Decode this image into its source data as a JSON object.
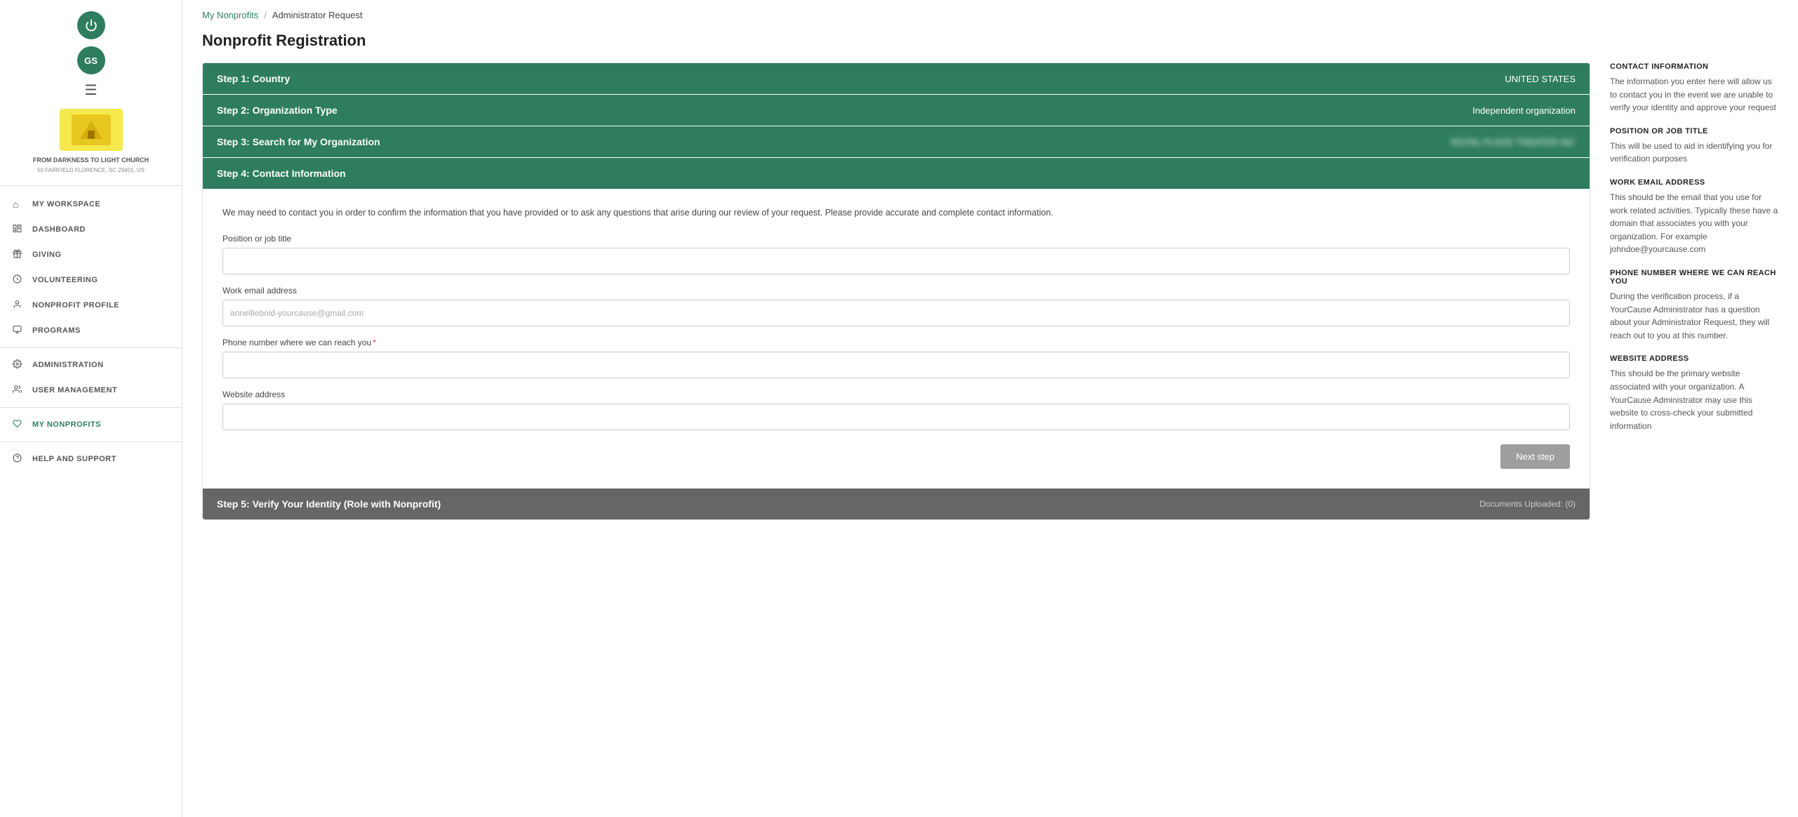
{
  "sidebar": {
    "power_icon": "⏻",
    "avatar_initials": "GS",
    "hamburger": "☰",
    "org_logo_letter": "🏠",
    "org_name": "FROM DARKNESS TO LIGHT CHURCH",
    "org_address": "50 FAIRFIELD FLORENCE, SC 29401, US",
    "nav_items": [
      {
        "id": "my-workspace",
        "label": "MY WORKSPACE",
        "icon": "⌂",
        "active": false
      },
      {
        "id": "dashboard",
        "label": "DASHBOARD",
        "icon": "📄",
        "active": false
      },
      {
        "id": "giving",
        "label": "GIVING",
        "icon": "🎁",
        "active": false
      },
      {
        "id": "volunteering",
        "label": "VOLUNTEERING",
        "icon": "☁",
        "active": false
      },
      {
        "id": "nonprofit-profile",
        "label": "NONPROFIT PROFILE",
        "icon": "👤",
        "active": false
      },
      {
        "id": "programs",
        "label": "PROGRAMS",
        "icon": "📊",
        "active": false
      },
      {
        "id": "administration",
        "label": "ADMINISTRATION",
        "icon": "⚙",
        "active": false
      },
      {
        "id": "user-management",
        "label": "USER MANAGEMENT",
        "icon": "👥",
        "active": false
      },
      {
        "id": "my-nonprofits",
        "label": "MY NONPROFITS",
        "icon": "♡",
        "active": true
      },
      {
        "id": "help-and-support",
        "label": "HELP AND SUPPORT",
        "icon": "⊙",
        "active": false
      }
    ]
  },
  "breadcrumb": {
    "link_text": "My Nonprofits",
    "separator": "/",
    "current": "Administrator Request"
  },
  "page": {
    "title": "Nonprofit Registration"
  },
  "steps": {
    "step1_label": "Step 1: Country",
    "step1_value": "UNITED STATES",
    "step2_label": "Step 2: Organization Type",
    "step2_value": "Independent organization",
    "step3_label": "Step 3: Search for My Organization",
    "step3_value": "ROYAL PLACE THEATER INC",
    "step4_label": "Step 4: Contact Information",
    "step5_label": "Step 5: Verify Your Identity (Role with Nonprofit)",
    "step5_value": "Documents Uploaded: (0)"
  },
  "form": {
    "description": "We may need to contact you in order to confirm the information that you have provided or to ask any questions that arise during our review of your request. Please provide accurate and complete contact information.",
    "field_position_label": "Position or job title",
    "field_position_value": "",
    "field_position_placeholder": "",
    "field_email_label": "Work email address",
    "field_email_value": "annelliebold-yourcause@gmail.com",
    "field_phone_label": "Phone number where we can reach you",
    "field_phone_required": "*",
    "field_phone_value": "",
    "field_website_label": "Website address",
    "field_website_value": "",
    "next_step_label": "Next step"
  },
  "right_panel": {
    "sections": [
      {
        "title": "CONTACT INFORMATION",
        "text": "The information you enter here will allow us to contact you in the event we are unable to verify your identity and approve your request"
      },
      {
        "title": "POSITION OR JOB TITLE",
        "text": "This will be used to aid in identifying you for verification purposes"
      },
      {
        "title": "WORK EMAIL ADDRESS",
        "text": "This should be the email that you use for work related activities. Typically these have a domain that associates you with your organization. For example johndoe@yourcause.com"
      },
      {
        "title": "PHONE NUMBER WHERE WE CAN REACH YOU",
        "text": "During the verification process, if a YourCause Administrator has a question about your Administrator Request, they will reach out to you at this number."
      },
      {
        "title": "WEBSITE ADDRESS",
        "text": "This should be the primary website associated with your organization. A YourCause Administrator may use this website to cross-check your submitted information"
      }
    ]
  }
}
